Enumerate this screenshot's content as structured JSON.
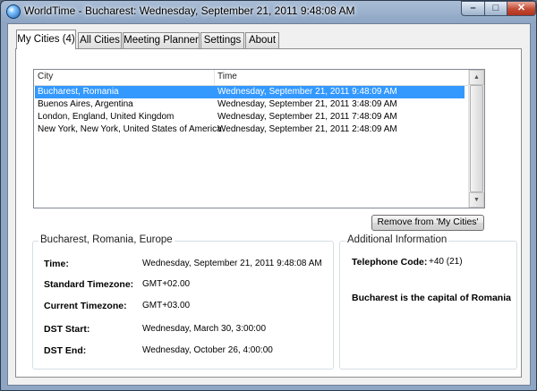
{
  "window": {
    "title": "WorldTime - Bucharest: Wednesday, September 21, 2011 9:48:08 AM",
    "controls": {
      "minimize": "–",
      "maximize": "□",
      "close": "✕"
    }
  },
  "tabs": [
    {
      "label": "My Cities (4)",
      "active": true
    },
    {
      "label": "All Cities",
      "active": false
    },
    {
      "label": "Meeting Planner",
      "active": false
    },
    {
      "label": "Settings",
      "active": false
    },
    {
      "label": "About",
      "active": false
    }
  ],
  "city_list": {
    "columns": [
      "City",
      "Time"
    ],
    "rows": [
      {
        "city": "Bucharest, Romania",
        "time": "Wednesday, September 21, 2011 9:48:09 AM",
        "selected": true
      },
      {
        "city": "Buenos Aires, Argentina",
        "time": "Wednesday, September 21, 2011 3:48:09 AM",
        "selected": false
      },
      {
        "city": "London, England, United Kingdom",
        "time": "Wednesday, September 21, 2011 7:48:09 AM",
        "selected": false
      },
      {
        "city": "New York, New York, United States of America",
        "time": "Wednesday, September 21, 2011 2:48:09 AM",
        "selected": false
      }
    ]
  },
  "remove_button": {
    "label": "Remove from 'My Cities'"
  },
  "city_details": {
    "title": "Bucharest, Romania, Europe",
    "time_label": "Time:",
    "time_value": "Wednesday, September 21, 2011 9:48:08 AM",
    "standard_tz_label": "Standard Timezone:",
    "standard_tz_value": "GMT+02.00",
    "current_tz_label": "Current Timezone:",
    "current_tz_value": "GMT+03.00",
    "dst_start_label": "DST Start:",
    "dst_start_value": "Wednesday, March 30, 3:00:00",
    "dst_end_label": "DST End:",
    "dst_end_value": "Wednesday, October 26, 4:00:00"
  },
  "additional_info": {
    "title": "Additional Information",
    "telephone_label": "Telephone Code:",
    "telephone_value": "+40 (21)",
    "note": "Bucharest is the capital of Romania"
  },
  "colors": {
    "selection": "#3399ff",
    "titlebar": "#8ea6c4",
    "close_button": "#c24a33"
  }
}
